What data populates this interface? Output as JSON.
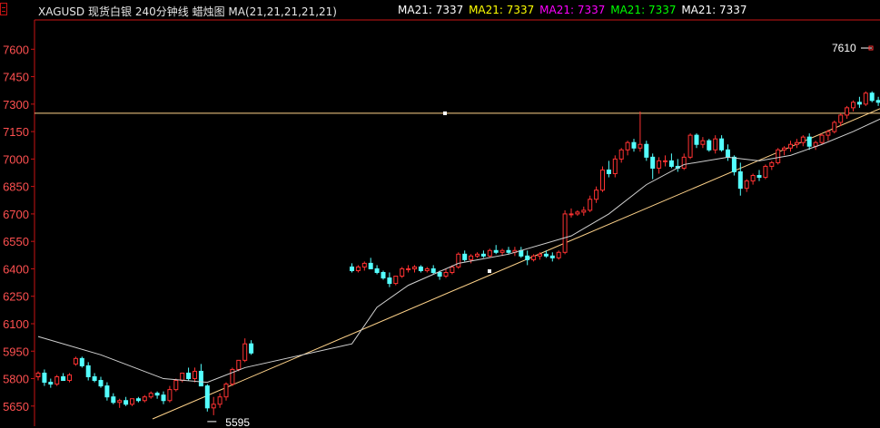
{
  "header": {
    "symbol": "XAGUSD",
    "name": "现货白银",
    "period": "240分钟线",
    "chart_kind": "蜡烛图",
    "indicator": "MA(21,21,21,21,21)",
    "ma_readouts": [
      {
        "label": "MA21:",
        "value": "7337",
        "color": "#ffffff"
      },
      {
        "label": "MA21:",
        "value": "7337",
        "color": "#ffff00"
      },
      {
        "label": "MA21:",
        "value": "7337",
        "color": "#ff00ff"
      },
      {
        "label": "MA21:",
        "value": "7337",
        "color": "#00ff00"
      },
      {
        "label": "MA21:",
        "value": "7337",
        "color": "#ffffff"
      }
    ]
  },
  "colors": {
    "up": "#ff3232",
    "down": "#54ffff",
    "axis": "#c81414",
    "tick_label": "#ff5050",
    "ma_line": "#d0d0d0",
    "trendline": "#ffd38a"
  },
  "chart_data": {
    "type": "candlestick",
    "ylim": [
      5540,
      7760
    ],
    "yticks": [
      7600,
      7450,
      7300,
      7150,
      7000,
      6850,
      6700,
      6550,
      6400,
      6250,
      6100,
      5950,
      5800,
      5650
    ],
    "gap_after_index": 34,
    "ohlc": [
      [
        5810,
        5840,
        5790,
        5830
      ],
      [
        5830,
        5850,
        5760,
        5780
      ],
      [
        5780,
        5800,
        5750,
        5770
      ],
      [
        5770,
        5820,
        5760,
        5810
      ],
      [
        5810,
        5830,
        5790,
        5790
      ],
      [
        5790,
        5830,
        5780,
        5820
      ],
      [
        5880,
        5920,
        5870,
        5910
      ],
      [
        5910,
        5920,
        5860,
        5870
      ],
      [
        5870,
        5890,
        5790,
        5810
      ],
      [
        5810,
        5830,
        5780,
        5790
      ],
      [
        5790,
        5810,
        5750,
        5760
      ],
      [
        5760,
        5780,
        5680,
        5700
      ],
      [
        5700,
        5720,
        5660,
        5670
      ],
      [
        5670,
        5690,
        5640,
        5680
      ],
      [
        5680,
        5700,
        5650,
        5660
      ],
      [
        5660,
        5690,
        5650,
        5690
      ],
      [
        5690,
        5700,
        5670,
        5680
      ],
      [
        5680,
        5710,
        5670,
        5700
      ],
      [
        5700,
        5730,
        5690,
        5720
      ],
      [
        5720,
        5730,
        5690,
        5710
      ],
      [
        5710,
        5730,
        5660,
        5680
      ],
      [
        5680,
        5760,
        5670,
        5740
      ],
      [
        5740,
        5800,
        5730,
        5790
      ],
      [
        5790,
        5830,
        5780,
        5830
      ],
      [
        5830,
        5860,
        5790,
        5800
      ],
      [
        5800,
        5860,
        5780,
        5840
      ],
      [
        5840,
        5880,
        5760,
        5760
      ],
      [
        5760,
        5770,
        5620,
        5640
      ],
      [
        5640,
        5700,
        5600,
        5660
      ],
      [
        5660,
        5720,
        5640,
        5700
      ],
      [
        5700,
        5780,
        5680,
        5770
      ],
      [
        5770,
        5860,
        5760,
        5850
      ],
      [
        5850,
        5900,
        5840,
        5900
      ],
      [
        5900,
        6020,
        5890,
        5990
      ],
      [
        5990,
        6010,
        5930,
        5940
      ],
      [
        6410,
        6430,
        6380,
        6390
      ],
      [
        6390,
        6420,
        6380,
        6410
      ],
      [
        6410,
        6440,
        6390,
        6430
      ],
      [
        6430,
        6460,
        6400,
        6400
      ],
      [
        6400,
        6420,
        6370,
        6380
      ],
      [
        6380,
        6390,
        6340,
        6350
      ],
      [
        6350,
        6380,
        6300,
        6320
      ],
      [
        6320,
        6360,
        6310,
        6360
      ],
      [
        6360,
        6410,
        6350,
        6400
      ],
      [
        6400,
        6420,
        6380,
        6400
      ],
      [
        6400,
        6420,
        6380,
        6410
      ],
      [
        6410,
        6420,
        6380,
        6390
      ],
      [
        6390,
        6410,
        6380,
        6400
      ],
      [
        6400,
        6420,
        6370,
        6380
      ],
      [
        6380,
        6390,
        6340,
        6360
      ],
      [
        6360,
        6400,
        6350,
        6380
      ],
      [
        6380,
        6420,
        6370,
        6410
      ],
      [
        6410,
        6490,
        6400,
        6480
      ],
      [
        6480,
        6500,
        6440,
        6450
      ],
      [
        6450,
        6480,
        6430,
        6470
      ],
      [
        6470,
        6490,
        6460,
        6480
      ],
      [
        6480,
        6500,
        6460,
        6470
      ],
      [
        6470,
        6510,
        6460,
        6500
      ],
      [
        6500,
        6530,
        6480,
        6490
      ],
      [
        6490,
        6510,
        6470,
        6500
      ],
      [
        6500,
        6520,
        6480,
        6490
      ],
      [
        6490,
        6520,
        6470,
        6500
      ],
      [
        6500,
        6520,
        6460,
        6470
      ],
      [
        6470,
        6500,
        6420,
        6450
      ],
      [
        6450,
        6480,
        6440,
        6470
      ],
      [
        6470,
        6490,
        6450,
        6480
      ],
      [
        6480,
        6500,
        6460,
        6470
      ],
      [
        6470,
        6490,
        6440,
        6460
      ],
      [
        6460,
        6500,
        6450,
        6490
      ],
      [
        6490,
        6720,
        6480,
        6700
      ],
      [
        6700,
        6730,
        6680,
        6700
      ],
      [
        6700,
        6720,
        6690,
        6710
      ],
      [
        6710,
        6740,
        6690,
        6720
      ],
      [
        6720,
        6800,
        6710,
        6780
      ],
      [
        6780,
        6850,
        6760,
        6830
      ],
      [
        6830,
        6960,
        6820,
        6940
      ],
      [
        6940,
        6990,
        6900,
        6920
      ],
      [
        6920,
        7020,
        6900,
        7000
      ],
      [
        7000,
        7060,
        6980,
        7050
      ],
      [
        7050,
        7100,
        7020,
        7090
      ],
      [
        7090,
        7110,
        7040,
        7060
      ],
      [
        7060,
        7260,
        7040,
        7080
      ],
      [
        7080,
        7100,
        6990,
        7010
      ],
      [
        7010,
        7030,
        6890,
        6950
      ],
      [
        6950,
        7010,
        6920,
        6990
      ],
      [
        6990,
        7020,
        6960,
        6990
      ],
      [
        6990,
        7030,
        6950,
        6960
      ],
      [
        6960,
        7000,
        6930,
        6950
      ],
      [
        6950,
        7030,
        6940,
        7010
      ],
      [
        7010,
        7140,
        7000,
        7130
      ],
      [
        7130,
        7140,
        7060,
        7080
      ],
      [
        7080,
        7120,
        7060,
        7100
      ],
      [
        7100,
        7110,
        7040,
        7050
      ],
      [
        7050,
        7130,
        7030,
        7110
      ],
      [
        7110,
        7130,
        7040,
        7050
      ],
      [
        7050,
        7080,
        6990,
        7010
      ],
      [
        7010,
        7020,
        6910,
        6930
      ],
      [
        6930,
        6980,
        6800,
        6840
      ],
      [
        6840,
        6890,
        6820,
        6880
      ],
      [
        6880,
        6920,
        6860,
        6910
      ],
      [
        6910,
        6940,
        6880,
        6900
      ],
      [
        6900,
        6970,
        6890,
        6960
      ],
      [
        6960,
        6990,
        6940,
        6980
      ],
      [
        6980,
        7060,
        6970,
        7050
      ],
      [
        7050,
        7070,
        7020,
        7060
      ],
      [
        7060,
        7100,
        7040,
        7080
      ],
      [
        7080,
        7110,
        7060,
        7090
      ],
      [
        7090,
        7130,
        7070,
        7120
      ],
      [
        7120,
        7140,
        7050,
        7070
      ],
      [
        7070,
        7100,
        7050,
        7090
      ],
      [
        7090,
        7140,
        7080,
        7130
      ],
      [
        7130,
        7160,
        7100,
        7150
      ],
      [
        7150,
        7210,
        7140,
        7200
      ],
      [
        7200,
        7250,
        7180,
        7240
      ],
      [
        7240,
        7290,
        7220,
        7280
      ],
      [
        7280,
        7320,
        7260,
        7310
      ],
      [
        7310,
        7340,
        7280,
        7300
      ],
      [
        7300,
        7370,
        7290,
        7360
      ],
      [
        7360,
        7370,
        7310,
        7320
      ],
      [
        7320,
        7340,
        7290,
        7310
      ],
      [
        7310,
        7330,
        7290,
        7320
      ],
      [
        7320,
        7380,
        7300,
        7370
      ],
      [
        7370,
        7400,
        7300,
        7320
      ],
      [
        7320,
        7350,
        7290,
        7340
      ],
      [
        7340,
        7360,
        7270,
        7280
      ],
      [
        7280,
        7320,
        7250,
        7300
      ],
      [
        7300,
        7320,
        7260,
        7290
      ],
      [
        7290,
        7310,
        7260,
        7280
      ],
      [
        7280,
        7300,
        7260,
        7290
      ],
      [
        7290,
        7310,
        7270,
        7300
      ],
      [
        7300,
        7470,
        7290,
        7460
      ],
      [
        7460,
        7480,
        7440,
        7470
      ],
      [
        7470,
        7490,
        7460,
        7480
      ]
    ],
    "ma21": [
      [
        0,
        6030
      ],
      [
        10,
        5930
      ],
      [
        20,
        5800
      ],
      [
        27,
        5780
      ],
      [
        33,
        5860
      ],
      [
        35,
        5990
      ],
      [
        39,
        6190
      ],
      [
        44,
        6310
      ],
      [
        52,
        6430
      ],
      [
        60,
        6480
      ],
      [
        70,
        6580
      ],
      [
        76,
        6700
      ],
      [
        82,
        6860
      ],
      [
        88,
        6970
      ],
      [
        95,
        7010
      ],
      [
        100,
        6990
      ],
      [
        105,
        7020
      ],
      [
        110,
        7080
      ],
      [
        115,
        7150
      ],
      [
        120,
        7230
      ],
      [
        126,
        7250
      ],
      [
        132,
        7330
      ]
    ],
    "trendlines": [
      {
        "from": [
          5550,
          5560
        ],
        "to": [
          7560,
          7300
        ],
        "unit": "x-index-rel",
        "endpoints_x_rel": [
          0.135,
          1.0
        ]
      },
      {
        "horizontal": 7250
      }
    ],
    "labels": {
      "low": "5595",
      "last": "7610"
    }
  }
}
